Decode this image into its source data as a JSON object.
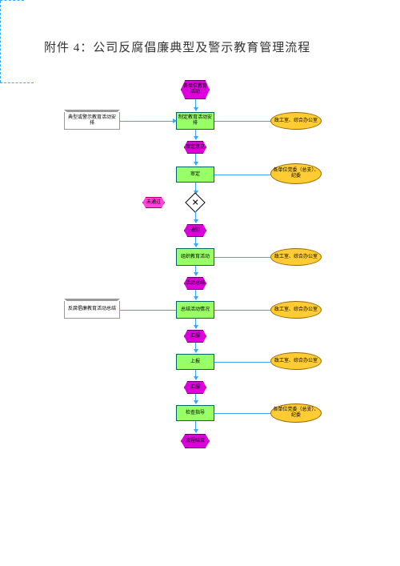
{
  "title": "附件 4：公司反腐倡廉典型及警示教育管理流程",
  "nodes": {
    "start": "各单位教育活动",
    "n1": "制定教育活动安排",
    "h1": "审定意见",
    "n2": "审定",
    "h2": "通知",
    "n3": "组织教育活动",
    "h3": "活动总结",
    "n4": "总结活动情况",
    "h4": "汇报",
    "n5": "上报",
    "h5": "汇报",
    "n6": "检查指导",
    "end": "流程结束",
    "reject": "未通过"
  },
  "orgs": {
    "o1": "政工室、综合办公室",
    "o2": "各单位党委（总支）、纪委",
    "o3": "政工室、综合办公室",
    "o4": "政工室、综合办公室",
    "o5": "政工室、综合办公室",
    "o6": "各单位党委（总支）、纪委"
  },
  "notes": {
    "note1": "典型或警示教育活动安排",
    "note2": "反腐倡廉教育活动总结"
  }
}
